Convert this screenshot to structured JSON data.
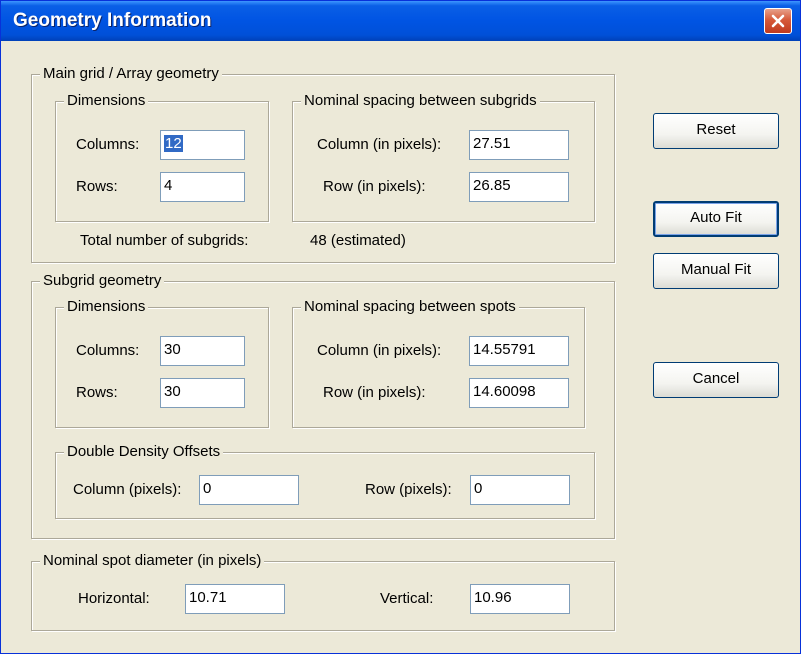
{
  "window": {
    "title": "Geometry Information"
  },
  "main_grid": {
    "title": "Main grid / Array geometry",
    "dimensions": {
      "title": "Dimensions",
      "columns_label": "Columns:",
      "columns_value": "12",
      "rows_label": "Rows:",
      "rows_value": "4"
    },
    "spacing": {
      "title": "Nominal spacing between subgrids",
      "column_label": "Column (in pixels):",
      "column_value": "27.51",
      "row_label": "Row (in pixels):",
      "row_value": "26.85"
    },
    "total_label": "Total number of subgrids:",
    "total_value": "48 (estimated)"
  },
  "subgrid": {
    "title": "Subgrid geometry",
    "dimensions": {
      "title": "Dimensions",
      "columns_label": "Columns:",
      "columns_value": "30",
      "rows_label": "Rows:",
      "rows_value": "30"
    },
    "spacing": {
      "title": "Nominal spacing between spots",
      "column_label": "Column (in pixels):",
      "column_value": "14.55791",
      "row_label": "Row (in pixels):",
      "row_value": "14.60098"
    },
    "offsets": {
      "title": "Double Density Offsets",
      "column_label": "Column (pixels):",
      "column_value": "0",
      "row_label": "Row (pixels):",
      "row_value": "0"
    }
  },
  "spot": {
    "title": "Nominal spot diameter (in pixels)",
    "horizontal_label": "Horizontal:",
    "horizontal_value": "10.71",
    "vertical_label": "Vertical:",
    "vertical_value": "10.96"
  },
  "buttons": {
    "reset": "Reset",
    "auto_fit": "Auto Fit",
    "manual_fit": "Manual Fit",
    "cancel": "Cancel"
  },
  "icons": {
    "close": "close-icon"
  },
  "colors": {
    "titlebar": "#0054e3",
    "close": "#d65a3a",
    "dialog": "#ece9d8",
    "selection": "#316ac5"
  }
}
